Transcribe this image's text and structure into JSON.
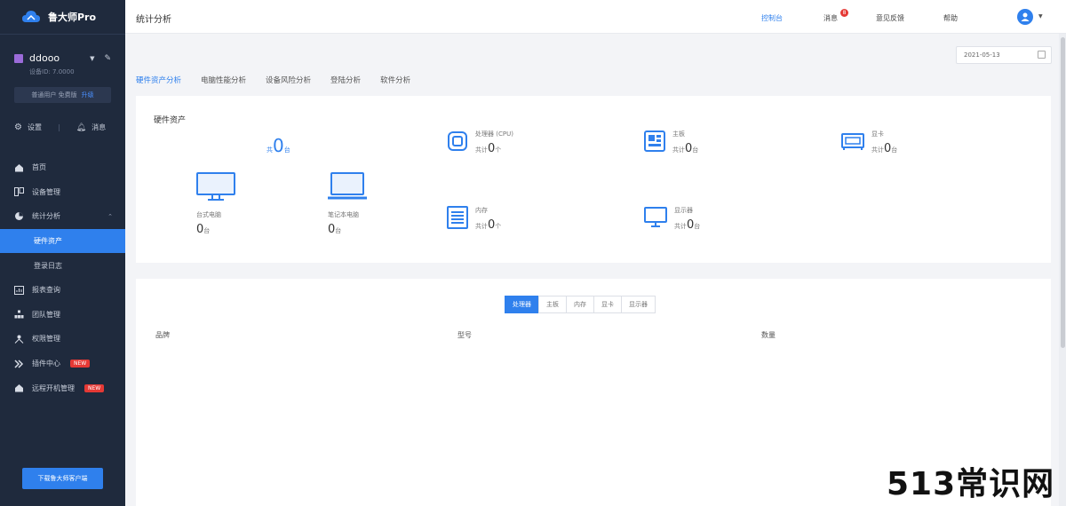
{
  "app": {
    "name": "鲁大师Pro"
  },
  "sidebar": {
    "user": {
      "name": "ddooo",
      "sub": "设备ID: 7.0000",
      "tag": "普通用户 免费版",
      "upgrade": "升级"
    },
    "actions": {
      "settings": "设置",
      "message": "消息"
    },
    "items": [
      {
        "label": "首页",
        "icon": "home-icon"
      },
      {
        "label": "设备管理",
        "icon": "devices-icon"
      },
      {
        "label": "统计分析",
        "icon": "pie-chart-icon",
        "expanded": true
      },
      {
        "label": "硬件资产",
        "sub": true,
        "active": true
      },
      {
        "label": "登录日志",
        "sub": true
      },
      {
        "label": "报表查询",
        "icon": "report-icon"
      },
      {
        "label": "团队管理",
        "icon": "team-icon"
      },
      {
        "label": "权限管理",
        "icon": "permission-icon"
      },
      {
        "label": "插件中心",
        "icon": "plugin-icon",
        "badge": "NEW"
      },
      {
        "label": "远程开机管理",
        "icon": "remote-icon",
        "badge": "NEW"
      }
    ],
    "download_label": "下载鲁大师客户端"
  },
  "topbar": {
    "title": "统计分析",
    "links": {
      "dashboard": "控制台",
      "messages": "消息",
      "notif_count": "8",
      "feedback": "意见反馈",
      "help": "帮助"
    }
  },
  "main": {
    "date": "2021-05-13",
    "tabs": [
      "硬件资产分析",
      "电脑性能分析",
      "设备风险分析",
      "登陆分析",
      "软件分析"
    ],
    "asset_card": {
      "title": "硬件资产",
      "total": {
        "label": "共",
        "value": "0",
        "unit": "台"
      },
      "stats": [
        {
          "label": "处理器 (CPU)",
          "prefix": "共计",
          "value": "0",
          "unit": "个",
          "icon": "cpu-icon"
        },
        {
          "label": "主板",
          "prefix": "共计",
          "value": "0",
          "unit": "台",
          "icon": "motherboard-icon"
        },
        {
          "label": "显卡",
          "prefix": "共计",
          "value": "0",
          "unit": "台",
          "icon": "gpu-icon"
        },
        {
          "label": "内存",
          "prefix": "共计",
          "value": "0",
          "unit": "个",
          "icon": "memory-icon"
        },
        {
          "label": "显示器",
          "prefix": "共计",
          "value": "0",
          "unit": "台",
          "icon": "display-icon"
        }
      ],
      "devices": [
        {
          "label": "台式电脑",
          "value": "0",
          "unit": "台",
          "icon": "desktop-icon"
        },
        {
          "label": "笔记本电脑",
          "value": "0",
          "unit": "台",
          "icon": "laptop-icon"
        }
      ]
    },
    "detail_card": {
      "segments": [
        "处理器",
        "主板",
        "内存",
        "显卡",
        "显示器"
      ],
      "columns": [
        "品牌",
        "型号",
        "数量"
      ]
    }
  },
  "watermark": "513常识网"
}
